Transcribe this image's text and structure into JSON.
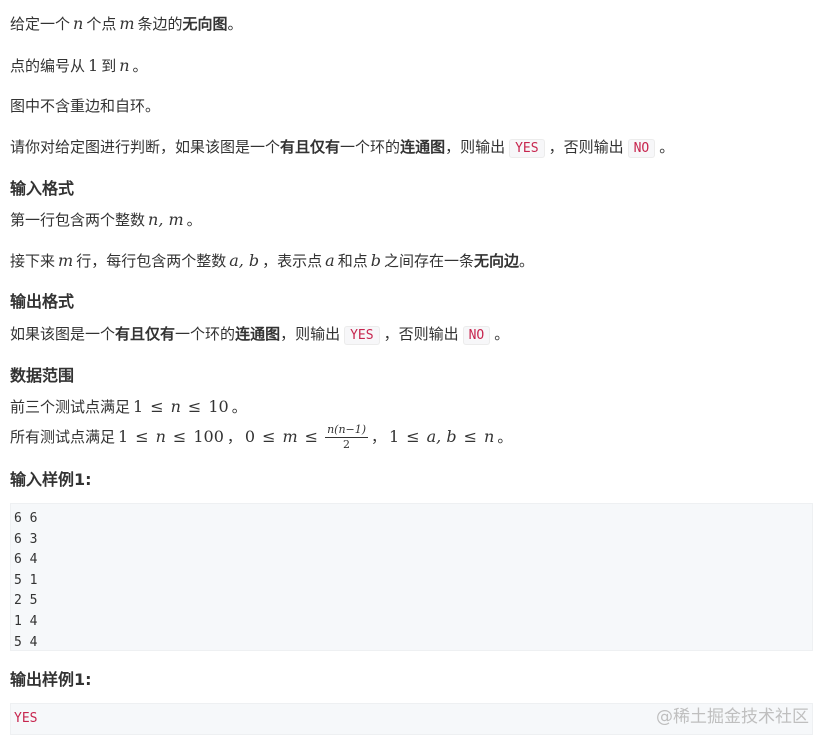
{
  "problem": {
    "line1": {
      "a": "给定一个",
      "n": "n",
      "b": "个点",
      "m": "m",
      "c": "条边的",
      "bold": "无向图",
      "d": "。"
    },
    "line2": {
      "a": "点的编号从",
      "one": "1",
      "b": "到",
      "n": "n",
      "c": "。"
    },
    "line3": "图中不含重边和自环。",
    "line4": {
      "a": "请你对给定图进行判断，如果该图是",
      "b1": "一个",
      "bold1": "有且仅有",
      "b2": "一个环的",
      "bold2": "连通图",
      "c": "，则输出",
      "yes": "YES",
      "d": "，否则输出",
      "no": "NO",
      "e": "。"
    }
  },
  "input_format": {
    "heading": "输入格式",
    "line1": {
      "a": "第一行包含两个整数",
      "vars": "n, m",
      "b": "。"
    },
    "line2": {
      "a": "接下来",
      "m": "m",
      "b": "行，每行包含两个整数",
      "ab": "a, b",
      "c": "，表示点",
      "pa": "a",
      "d": "和点",
      "pb": "b",
      "e": "之间存在一条",
      "bold": "无向边",
      "f": "。"
    }
  },
  "output_format": {
    "heading": "输出格式",
    "line": {
      "a": "如果该图是",
      "b1": "一个",
      "bold1": "有且仅有",
      "b2": "一个环的",
      "bold2": "连通图",
      "c": "，则输出",
      "yes": "YES",
      "d": "，否则输出",
      "no": "NO",
      "e": "。"
    }
  },
  "data_range": {
    "heading": "数据范围",
    "line1": {
      "a": "前三个测试点满足",
      "one": "1",
      "le1": "≤",
      "n": "n",
      "le2": "≤",
      "ten": "10",
      "b": "。"
    },
    "line2": {
      "a": "所有测试点满足",
      "one": "1",
      "le1": "≤",
      "n": "n",
      "le2": "≤",
      "hundred": "100",
      "sep1": "，",
      "zero": "0",
      "le3": "≤",
      "m": "m",
      "le4": "≤",
      "frac_num": "n(n−1)",
      "frac_den": "2",
      "sep2": "，",
      "one2": "1",
      "le5": "≤",
      "ab": "a, b",
      "le6": "≤",
      "n2": "n",
      "b": "。"
    }
  },
  "sample_input": {
    "heading": "输入样例1:",
    "text": "6 6\n6 3\n6 4\n5 1\n2 5\n1 4\n5 4"
  },
  "sample_output": {
    "heading": "输出样例1:",
    "text": "YES"
  },
  "watermark": "@稀土掘金技术社区"
}
